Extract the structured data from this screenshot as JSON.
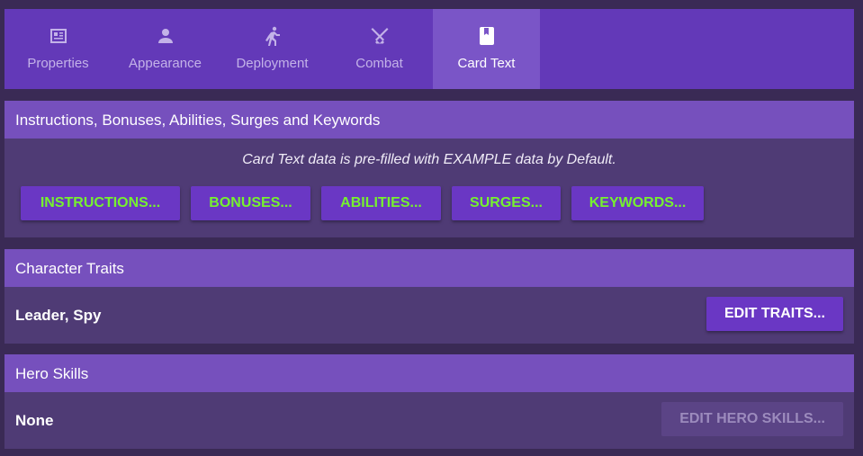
{
  "tabs": [
    {
      "label": "Properties",
      "icon": "properties-icon"
    },
    {
      "label": "Appearance",
      "icon": "person-icon"
    },
    {
      "label": "Deployment",
      "icon": "running-person-icon"
    },
    {
      "label": "Combat",
      "icon": "crossed-swords-icon"
    },
    {
      "label": "Card Text",
      "icon": "bookmark-card-icon",
      "active": true
    }
  ],
  "card_text": {
    "header": "Instructions, Bonuses, Abilities, Surges and Keywords",
    "note": "Card Text data is pre-filled with EXAMPLE data by Default.",
    "buttons": [
      "INSTRUCTIONS...",
      "BONUSES...",
      "ABILITIES...",
      "SURGES...",
      "KEYWORDS..."
    ]
  },
  "character_traits": {
    "header": "Character Traits",
    "value": "Leader, Spy",
    "button": "EDIT TRAITS..."
  },
  "hero_skills": {
    "header": "Hero Skills",
    "value": "None",
    "button": "EDIT HERO SKILLS...",
    "button_disabled": true
  },
  "colors": {
    "tabbar": "#6339b8",
    "active_tab": "#7a55c7",
    "section_header": "#7650bd",
    "section_body": "#4f3b75",
    "button": "#6a37c4",
    "button_text_green": "#76f12f"
  }
}
